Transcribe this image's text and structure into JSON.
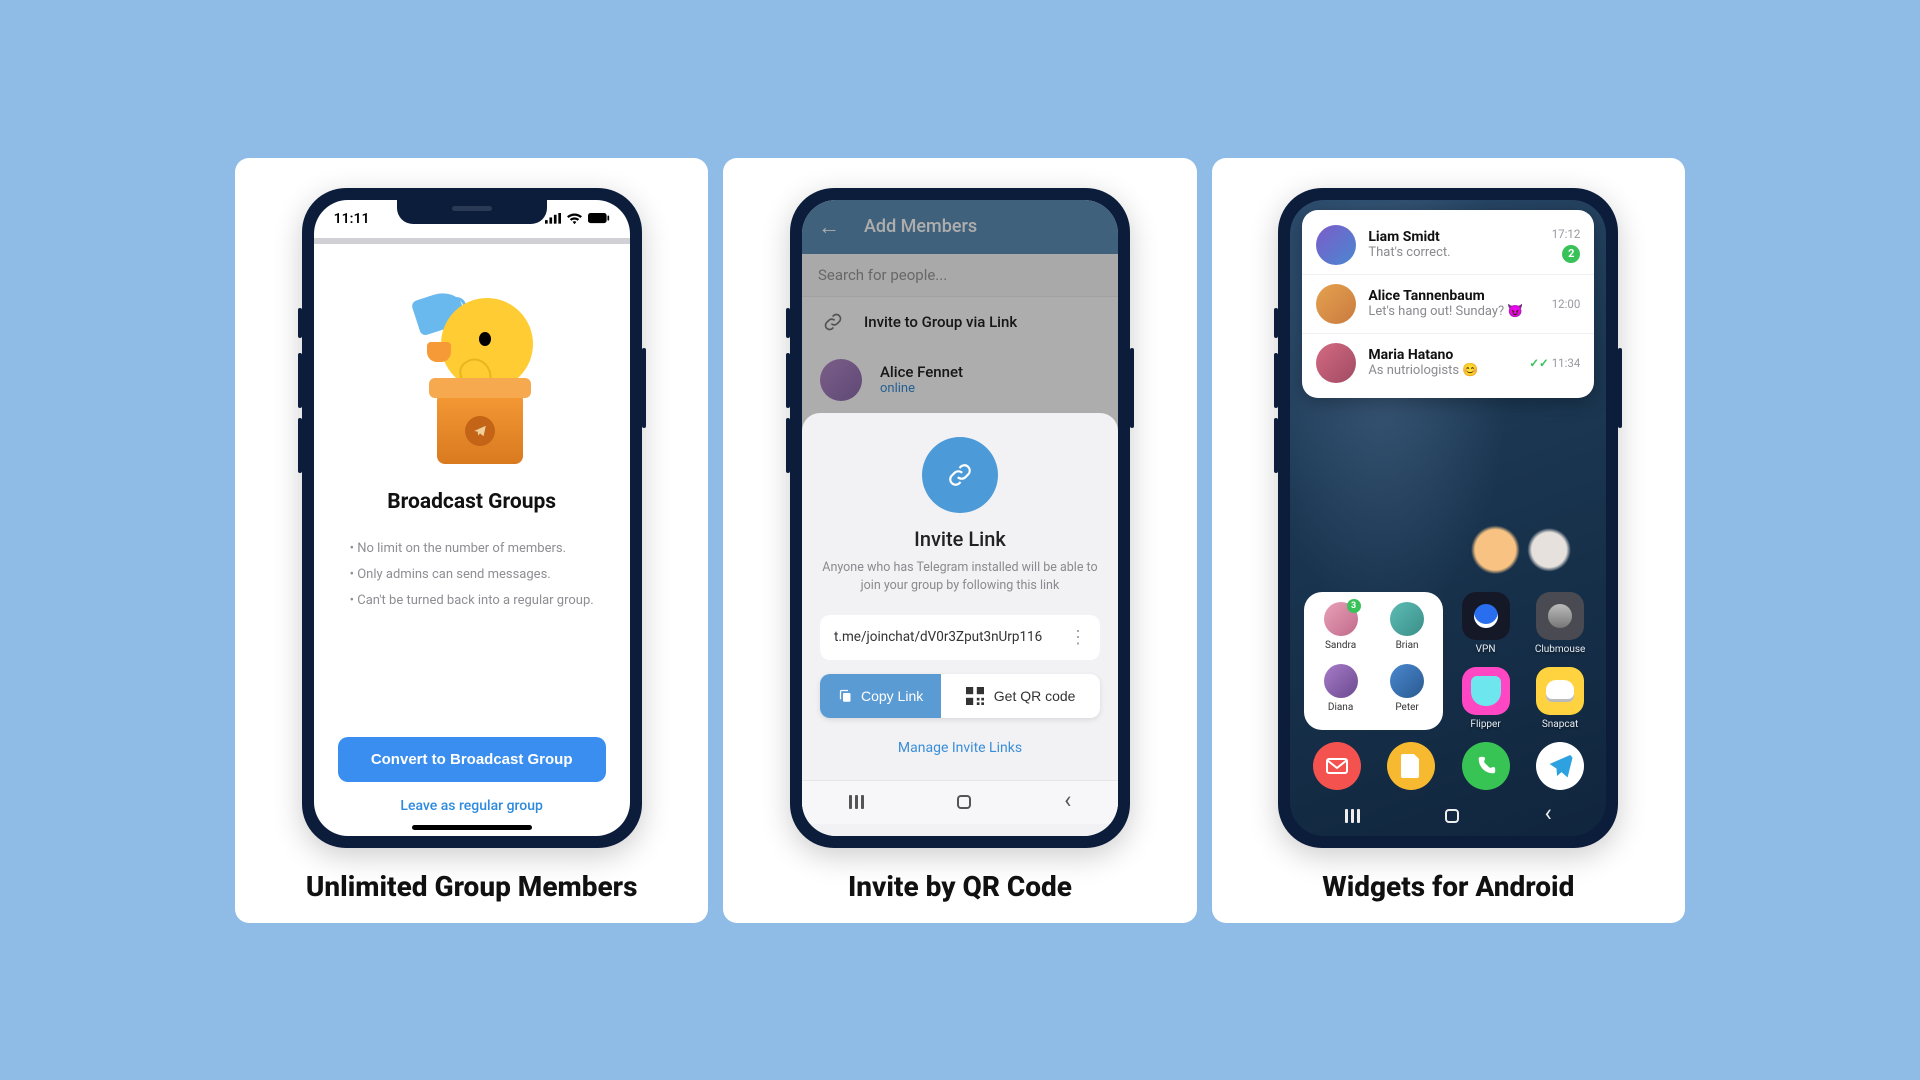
{
  "panels": [
    {
      "caption": "Unlimited Group Members"
    },
    {
      "caption": "Invite by QR Code"
    },
    {
      "caption": "Widgets for Android"
    }
  ],
  "panel1": {
    "time": "11:11",
    "title": "Broadcast Groups",
    "bullets": [
      "No limit on the number of members.",
      "Only admins can send messages.",
      "Can't be turned back into a regular group."
    ],
    "primary_btn": "Convert to Broadcast Group",
    "secondary_link": "Leave as regular group"
  },
  "panel2": {
    "header": "Add Members",
    "search_placeholder": "Search for people...",
    "invite_via_link_row": "Invite to Group via Link",
    "contact": {
      "name": "Alice Fennet",
      "status": "online"
    },
    "sheet_title": "Invite Link",
    "sheet_sub": "Anyone who has Telegram installed will be able to join your group by following this link",
    "link_value": "t.me/joinchat/dV0r3Zput3nUrp116",
    "copy_btn": "Copy Link",
    "qr_btn": "Get QR code",
    "manage_link": "Manage Invite Links"
  },
  "panel3": {
    "chats": [
      {
        "name": "Liam Smidt",
        "msg": "That's correct.",
        "time": "17:12",
        "unread": "2",
        "checks": false
      },
      {
        "name": "Alice Tannenbaum",
        "msg": "Let's hang out! Sunday? 😈",
        "time": "12:00",
        "unread": null,
        "checks": false
      },
      {
        "name": "Maria Hatano",
        "msg": "As nutriologists 😊",
        "time": "11:34",
        "unread": null,
        "checks": true
      }
    ],
    "contacts_widget": [
      {
        "name": "Sandra",
        "badge": "3"
      },
      {
        "name": "Brian"
      },
      {
        "name": "Diana"
      },
      {
        "name": "Peter"
      }
    ],
    "apps_row1": [
      {
        "name": "VPN",
        "cls": "t-vpn"
      },
      {
        "name": "Clubmouse",
        "cls": "t-club"
      }
    ],
    "apps_row2": [
      {
        "name": "Flipper",
        "cls": "t-flip"
      },
      {
        "name": "Snapcat",
        "cls": "t-snap"
      }
    ]
  }
}
